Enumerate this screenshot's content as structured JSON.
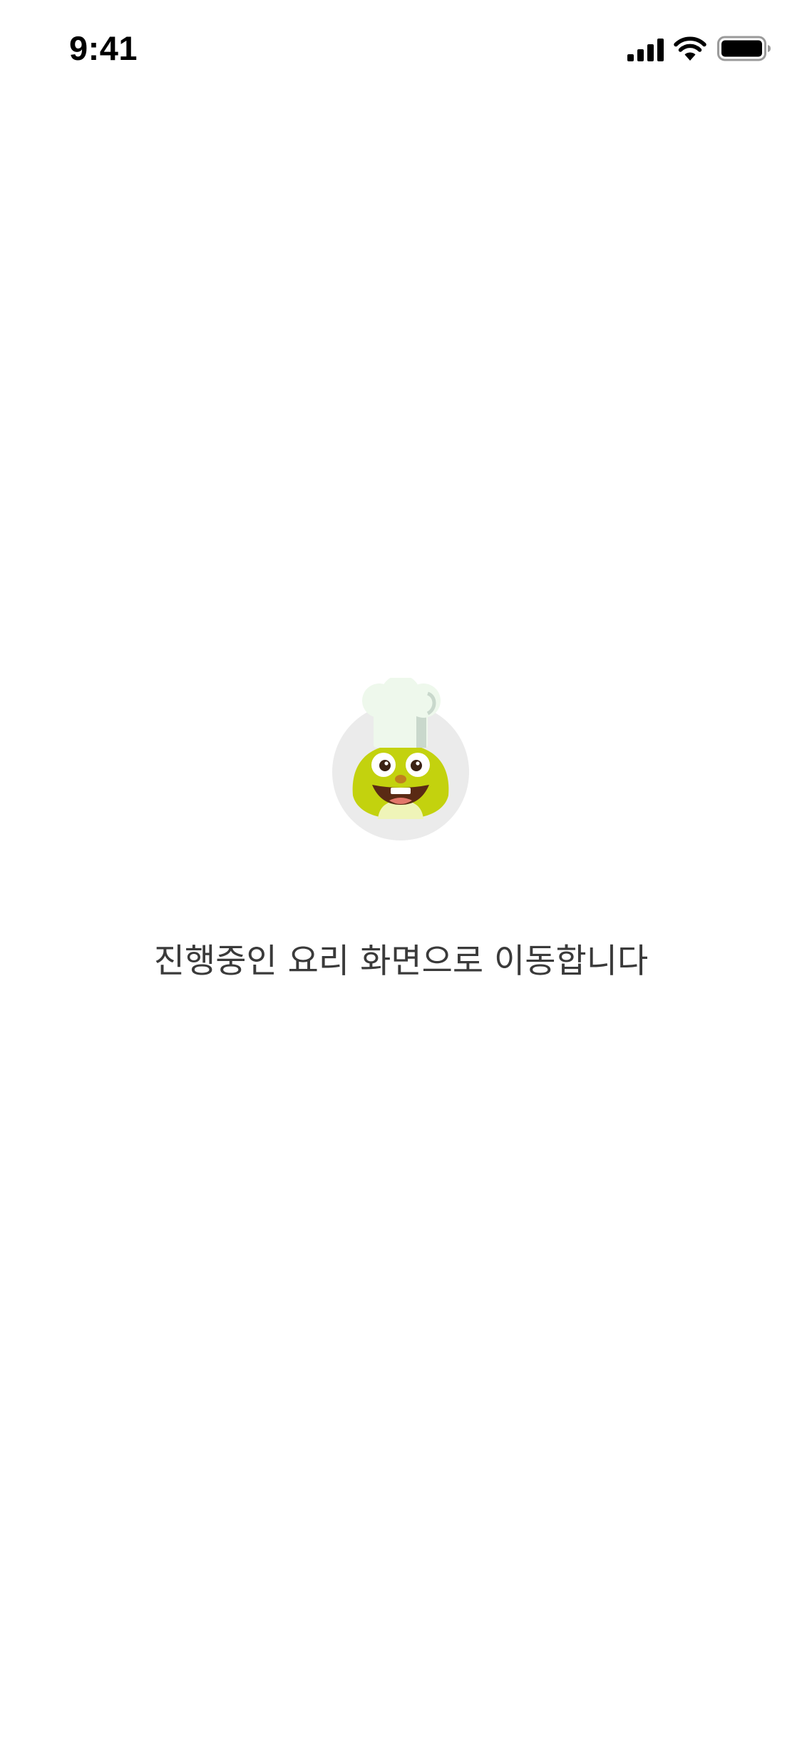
{
  "status_bar": {
    "time": "9:41",
    "icons": [
      "cellular-signal-icon",
      "wifi-icon",
      "battery-icon"
    ]
  },
  "loading": {
    "mascot_icon": "chef-mascot-icon",
    "message": "진행중인 요리 화면으로 이동합니다"
  },
  "colors": {
    "background": "#ffffff",
    "mascot_body": "#c3d20e",
    "mascot_circle": "#ebebeb",
    "chef_hat": "#eef8ec",
    "text": "#3a3a3a"
  }
}
